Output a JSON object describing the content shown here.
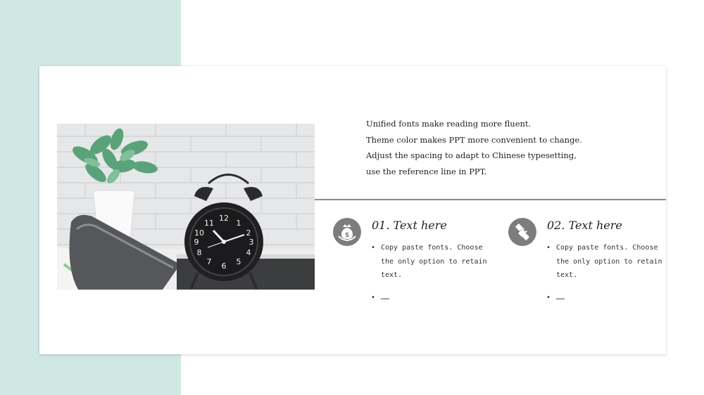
{
  "intro": {
    "lines": [
      "Unified fonts make reading more fluent.",
      "Theme color makes PPT more convenient to change.",
      "Adjust the spacing to adapt to Chinese typesetting,",
      "use the reference line in PPT."
    ]
  },
  "features": [
    {
      "icon": "money-bag-icon",
      "title": "01. Text here",
      "bullets": [
        "Copy paste fonts. Choose the only option to retain text.",
        "……"
      ]
    },
    {
      "icon": "handshake-icon",
      "title": "02. Text here",
      "bullets": [
        "Copy paste fonts. Choose the only option to retain text.",
        "……"
      ]
    }
  ],
  "colors": {
    "side_band": "#cfe8e3",
    "icon_circle": "#7d7d7d",
    "divider": "#8a8a8a"
  },
  "image": {
    "subject": "alarm-clock-plant-photo",
    "clock_numerals": [
      "12",
      "1",
      "2",
      "3",
      "4",
      "5",
      "6",
      "7",
      "8",
      "9",
      "10",
      "11"
    ]
  }
}
